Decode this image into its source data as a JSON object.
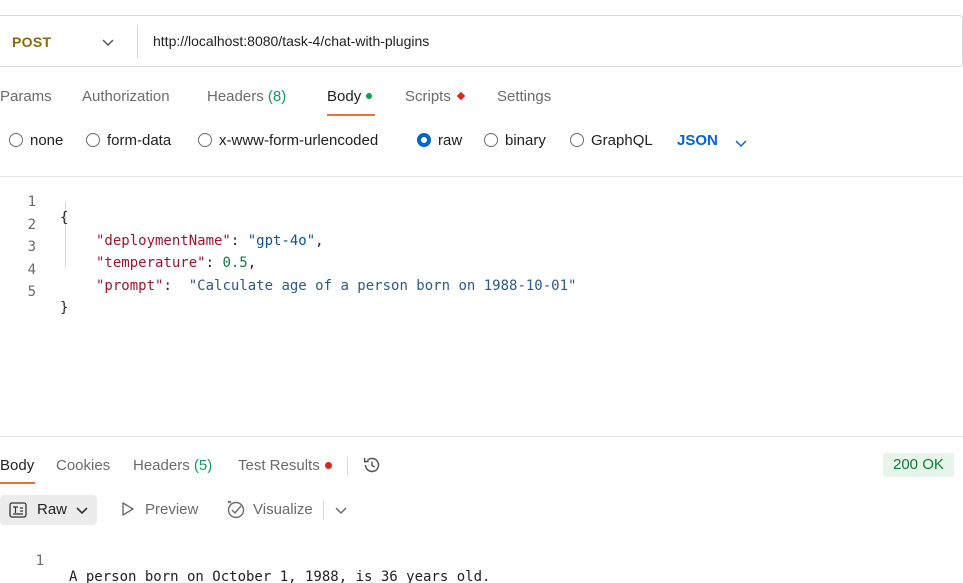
{
  "request": {
    "method": "POST",
    "url": "http://localhost:8080/task-4/chat-with-plugins"
  },
  "request_tabs": {
    "params": "Params",
    "authorization": "Authorization",
    "headers": "Headers",
    "headers_count": "(8)",
    "body": "Body",
    "scripts": "Scripts",
    "settings": "Settings",
    "active": "Body"
  },
  "body_types": {
    "none": "none",
    "form_data": "form-data",
    "urlencoded": "x-www-form-urlencoded",
    "raw": "raw",
    "binary": "binary",
    "graphql": "GraphQL",
    "selected": "raw",
    "format": "JSON"
  },
  "editor": {
    "line_numbers": [
      "1",
      "2",
      "3",
      "4",
      "5"
    ],
    "open_brace": "{",
    "close_brace": "}",
    "fields": [
      {
        "key": "\"deploymentName\"",
        "sep": ": ",
        "value": "\"gpt-4o\"",
        "trail": ","
      },
      {
        "key": "\"temperature\"",
        "sep": ": ",
        "value": "0.5",
        "trail": ","
      },
      {
        "key": "\"prompt\"",
        "sep": ":  ",
        "value": "\"Calculate age of a person born on 1988-10-01\"",
        "trail": ""
      }
    ]
  },
  "response_tabs": {
    "body": "Body",
    "cookies": "Cookies",
    "headers": "Headers",
    "headers_count": "(5)",
    "test_results": "Test Results",
    "status": "200 OK"
  },
  "response_view": {
    "raw": "Raw",
    "preview": "Preview",
    "visualize": "Visualize"
  },
  "response_body": {
    "line_number": "1",
    "text": "A person born on October 1, 1988, is 36 years old."
  },
  "colors": {
    "accent": "#e8703a",
    "link_blue": "#0265d2",
    "success_green": "#0f9d58",
    "error_red": "#e0271a"
  }
}
